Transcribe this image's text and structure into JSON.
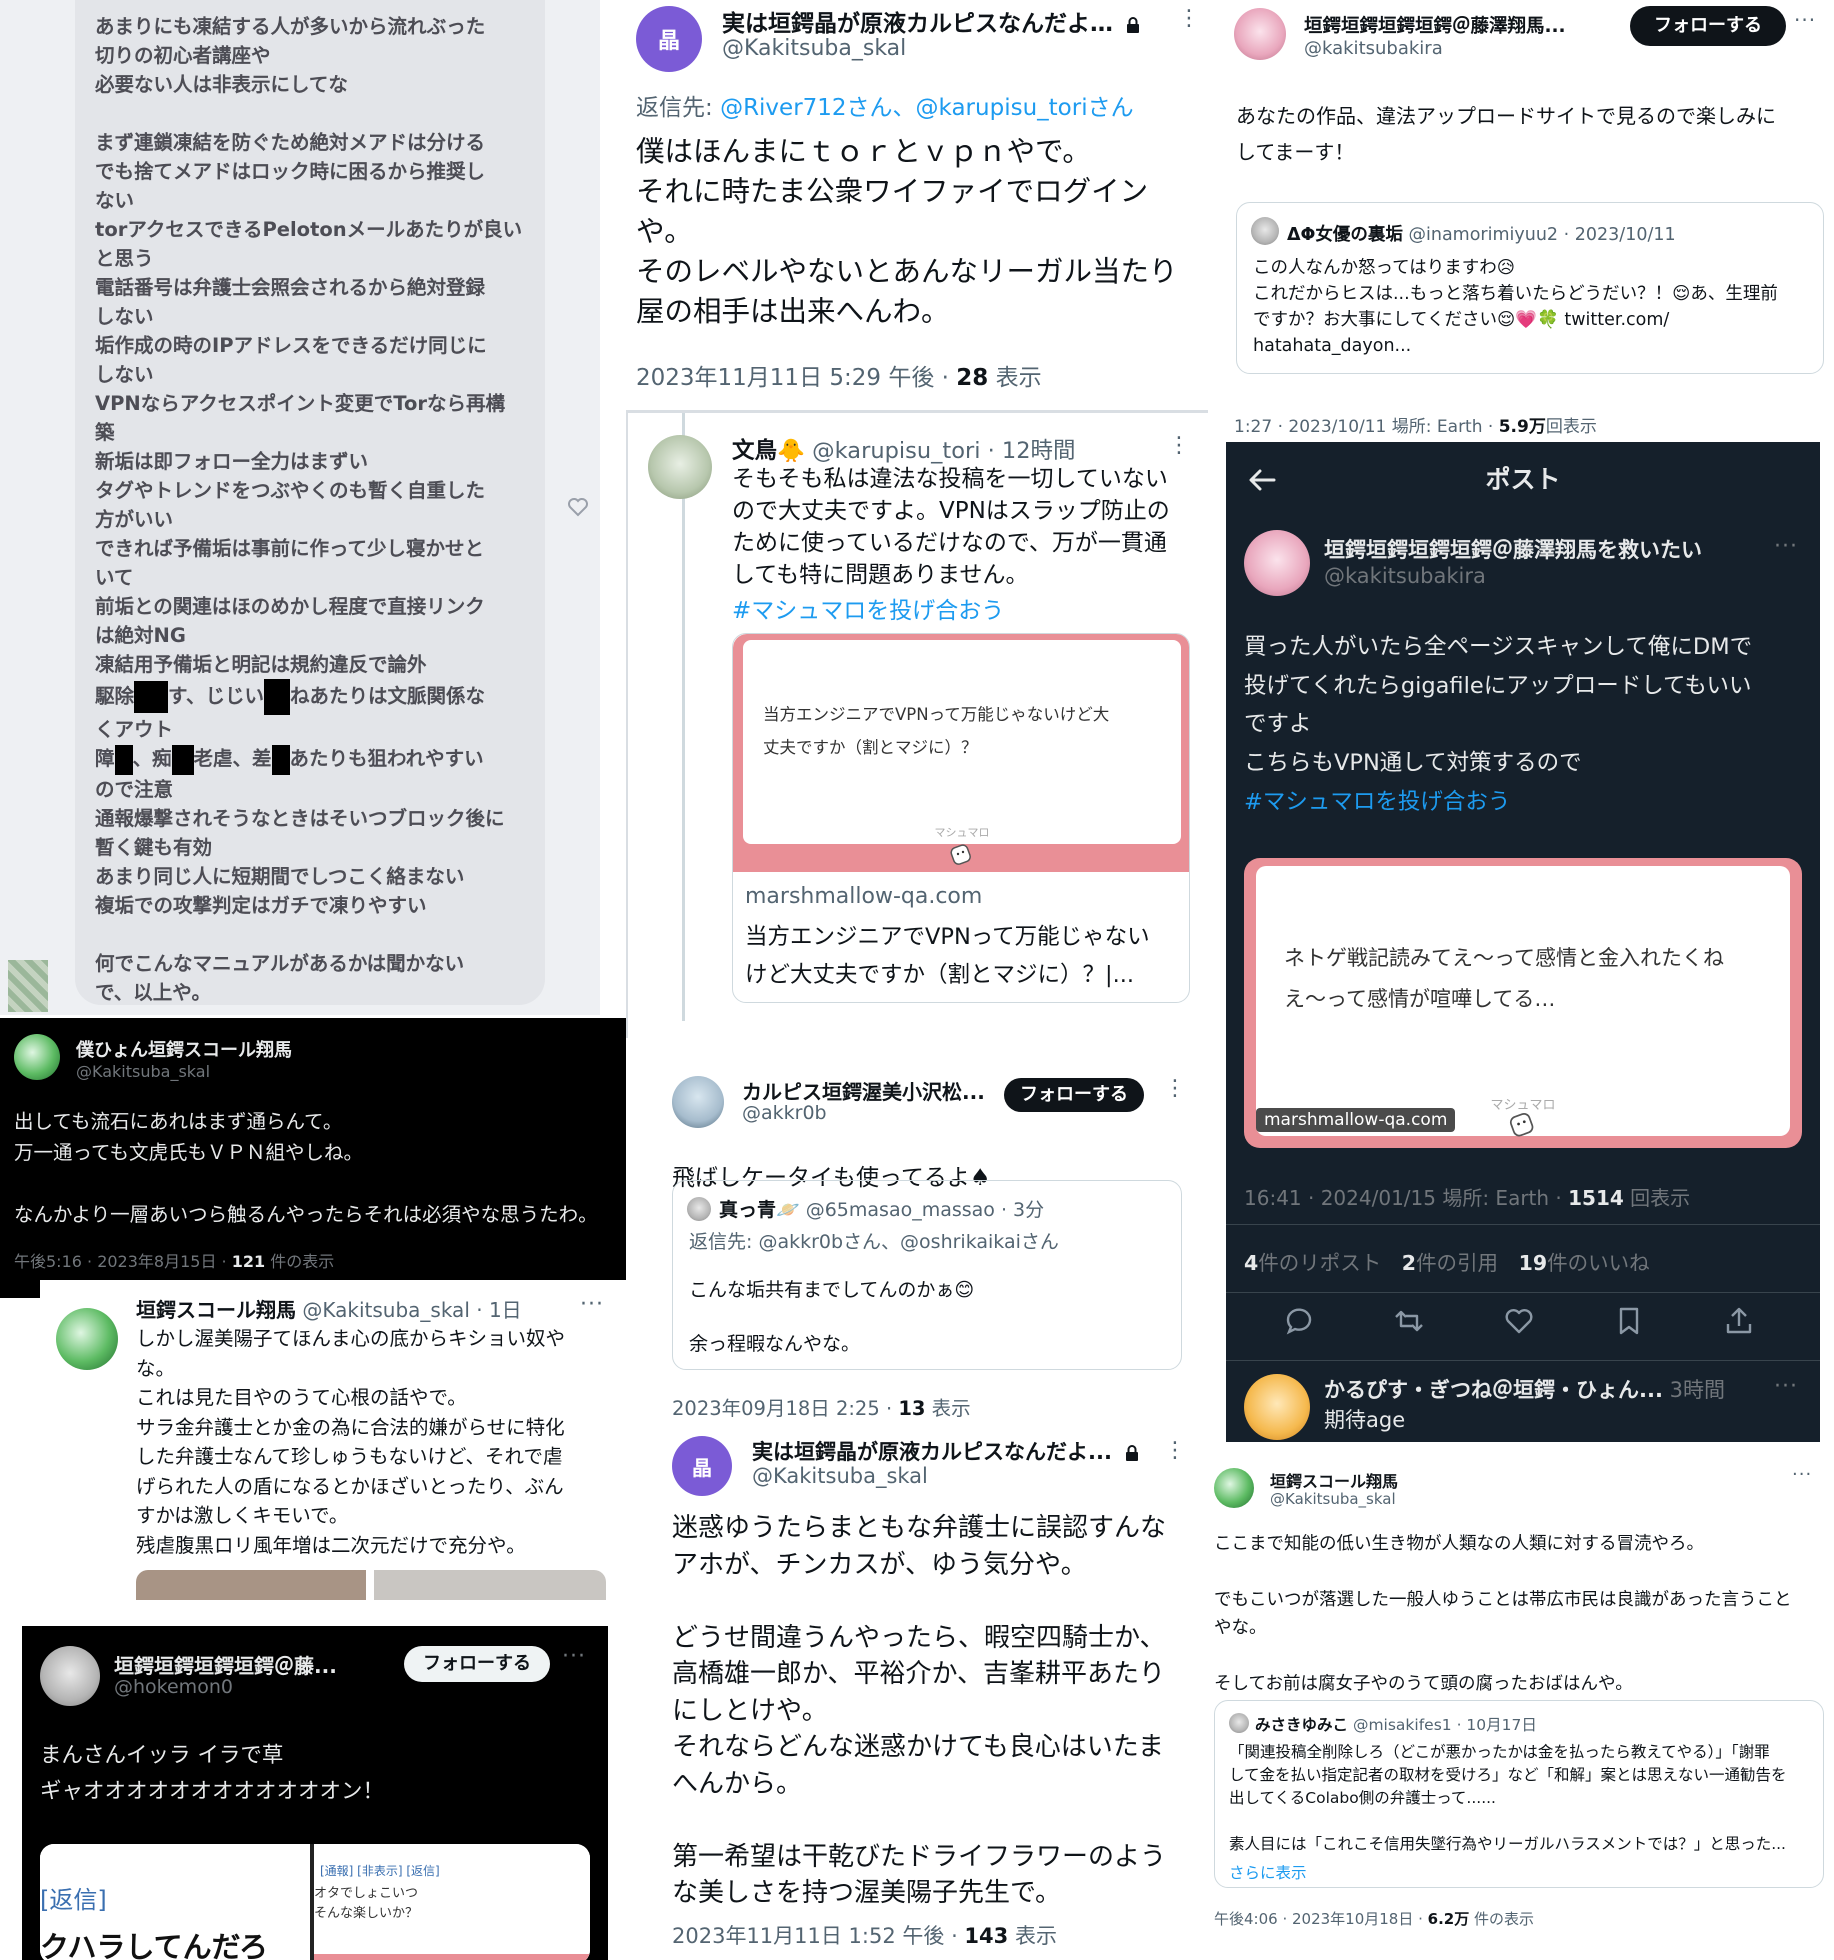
{
  "p1": {
    "lines": [
      "あまりにも凍結する人が多いから流れぶった",
      "切りの初心者講座や",
      "必要ない人は非表示にしてな",
      "",
      "まず連鎖凍結を防ぐため絶対メアドは分ける",
      "でも捨てメアドはロック時に困るから推奨し",
      "ない",
      "torアクセスできるPelotonメールあたりが良い",
      "と思う",
      "電話番号は弁護士会照会されるから絶対登録",
      "しない",
      "垢作成の時のIPアドレスをできるだけ同じに",
      "しない",
      "VPNならアクセスポイント変更でTorなら再構",
      "築",
      "新垢は即フォロー全力はまずい",
      "タグやトレンドをつぶやくのも暫く自重した",
      "方がいい",
      "できれば予備垢は事前に作って少し寝かせと",
      "いて",
      "前垢との関連はほのめかし程度で直接リンク",
      "は絶対NG",
      "凍結用予備垢と明記は規約違反で論外"
    ],
    "line_r1a": "駆除",
    "line_r1b": "す、じじい",
    "line_r1c": "ねあたりは文脈関係な",
    "line_r1d": "くアウト",
    "line_r2a": "障",
    "line_r2b": "、痴",
    "line_r2c": "老虐、差",
    "line_r2d": "あたりも狙われやすい",
    "lines_after": [
      "ので注意",
      "通報爆撃されそうなときはそいつブロック後に",
      "暫く鍵も有効",
      "あまり同じ人に短期間でしつこく絡まない",
      "複垢での攻撃判定はガチで凍りやすい",
      "",
      "何でこんなマニュアルがあるかは聞かない",
      "で、以上や。"
    ]
  },
  "p2": {
    "name": "実は垣鍔晶が原液カルピスなんだよ…",
    "handle": "@Kakitsuba_skal",
    "avatar_text": "晶",
    "reply_prefix": "返信先: ",
    "reply_to": "@River712さん、@karupisu_toriさん",
    "body": "僕はほんまにｔｏｒとｖｐｎやで。\nそれに時たま公衆ワイファイでログイン\nや。\nそのレベルやないとあんなリーガル当たり\n屋の相手は出来へんわ。",
    "time": "2023年11月11日 5:29 午後 · ",
    "views_count": "28",
    "views_label": " 表示"
  },
  "p3": {
    "name": "垣鍔垣鍔垣鍔垣鍔＠藤澤翔馬...",
    "handle": "@kakitsubakira",
    "follow": "フォローする",
    "body": "あなたの作品、違法アップロードサイトで見るので楽しみに\nしてまーす！",
    "q_name": "ΔΦ女優の裏垢",
    "q_handle": "@inamorimiyuu2 · 2023/10/11",
    "q_body": "この人なんか怒ってはりますわ😥\nこれだからヒスは...もっと落ち着いたらどうだい？！😌あ、生理前\nですか？お大事にしてください😌💗🍀 twitter.com/\nhatahata_dayon...",
    "meta_time": "1:27 · 2023/10/11 場所: Earth · ",
    "meta_views": "5.9万",
    "meta_label": "回表示"
  },
  "p4": {
    "name": "文鳥🐥",
    "handle": "@karupisu_tori · 12時間",
    "body": "そもそも私は違法な投稿を一切していない\nので大丈夫ですよ。VPNはスラップ防止の\nために使っているだけなので、万が一貫通\nしても特に問題ありません。",
    "hashtag": "#マシュマロを投げ合おう",
    "mm_question": "当方エンジニアでVPNって万能じゃないけど大\n丈夫ですか（割とマジに）？",
    "mm_label": "マシュマロ",
    "link_domain": "marshmallow-qa.com",
    "link_title": "当方エンジニアでVPNって万能じゃない\nけど大丈夫ですか（割とマジに）？|..."
  },
  "p5": {
    "header_title": "ポスト",
    "name": "垣鍔垣鍔垣鍔垣鍔＠藤澤翔馬を救いたい",
    "handle": "@kakitsubakira",
    "body": "買った人がいたら全ページスキャンして俺にDMで\n投げてくれたらgigafileにアップロードしてもいい\nですよ\nこちらもVPN通して対策するので",
    "hashtag": "#マシュマロを投げ合おう",
    "mm_question": "ネトゲ戦記読みてえ〜って感情と金入れたくね\nえ〜って感情が喧嘩してる…",
    "mm_label": "マシュマロ",
    "mm_domain": "marshmallow-qa.com",
    "meta": "16:41 · 2024/01/15 場所: Earth · ",
    "meta_views": "1514",
    "meta_label": " 回表示",
    "reposts_n": "4",
    "reposts_l": "件のリポスト",
    "quotes_n": "2",
    "quotes_l": "件の引用",
    "likes_n": "19",
    "likes_l": "件のいいね",
    "reply_name": "かるぴす・ぎつね＠垣鍔・ひょん...",
    "reply_time": "3時間",
    "reply_body": "期待age"
  },
  "p6": {
    "name": "僕ひょん垣鍔スコール翔馬",
    "handle": "@Kakitsuba_skal",
    "body": "出しても流石にあれはまず通らんて。\n万一通っても文虎氏もＶＰＮ組やしね。\n\nなんかより一層あいつら触るんやったらそれは必須やな思うたわ。",
    "time": "午後5:16 · 2023年8月15日 · ",
    "views": "121",
    "views_label": " 件の表示"
  },
  "p7": {
    "name": "垣鍔スコール翔馬",
    "handle": "@Kakitsuba_skal · 1日",
    "body": "しかし渥美陽子てほんま心の底からキショい奴や\nな。\nこれは見た目やのうて心根の話やで。\nサラ金弁護士とか金の為に合法的嫌がらせに特化\nした弁護士なんて珍しゅうもないけど、それで虐\nげられた人の盾になるとかほざいとったり、ぶん\nすかは激しくキモいで。\n残虐腹黒ロリ風年増は二次元だけで充分や。"
  },
  "p8": {
    "name": "カルピス垣鍔渥美小沢松...",
    "handle": "@akkr0b",
    "follow": "フォローする",
    "body": "飛ばしケータイも使ってるよ♠",
    "q_name": "真っ青🪐",
    "q_handle": "@65masao_massao · 3分",
    "q_reply": "返信先: @akkr0bさん、@oshrikaikaiさん",
    "q_body": "こんな垢共有までしてんのかぁ😊\n\n余っ程暇なんやな。",
    "time": "2023年09月18日 2:25 · ",
    "views": "13",
    "views_label": " 表示"
  },
  "p9": {
    "name": "実は垣鍔晶が原液カルピスなんだよ...",
    "handle": "@Kakitsuba_skal",
    "avatar_text": "晶",
    "body": "迷惑ゆうたらまともな弁護士に誤認すんな\nアホが、チンカスが、ゆう気分や。\n\nどうせ間違うんやったら、暇空四騎士か、\n高橋雄一郎か、平裕介か、吉峯耕平あたり\nにしとけや。\nそれならどんな迷惑かけても良心はいたま\nへんから。\n\n第一希望は干乾びたドライフラワーのよう\nな美しさを持つ渥美陽子先生で。",
    "time": "2023年11月11日 1:52 午後 · ",
    "views": "143",
    "views_label": " 表示"
  },
  "p10": {
    "name": "垣鍔スコール翔馬",
    "handle": "@Kakitsuba_skal",
    "body": "ここまで知能の低い生き物が人類なの人類に対する冒涜やろ。\n\nでもこいつが落選した一般人ゆうことは帯広市民は良識があった言うこと\nやな。\n\nそしてお前は腐女子やのうて頭の腐ったおばはんや。",
    "q_name": "みさきゆみこ",
    "q_handle": "@misakifes1 · 10月17日",
    "q_body": "「関連投稿全削除しろ（どこが悪かったかは金を払ったら教えてやる）」「謝罪\nして金を払い指定記者の取材を受けろ」など「和解」案とは思えない一通勧告を\n出してくるColabo側の弁護士って......\n\n素人目には「これこそ信用失墜行為やリーガルハラスメントでは？」と思った...",
    "q_more": "さらに表示",
    "time": "午後4:06 · 2023年10月18日 · ",
    "views": "6.2万",
    "views_label": " 件の表示"
  },
  "p11": {
    "name": "垣鍔垣鍔垣鍔垣鍔＠藤...",
    "handle": "@hokemon0",
    "follow": "フォローする",
    "body": "まんさんイッラ イラで草\nギャオオオオオオオオオオオオン！",
    "left_tag": "[返信]",
    "left_text": "クハラしてんだろ",
    "right_tags": "[通報] [非表示] [返信]",
    "right_text": "オタでしょこいつ\nそんな楽しいか？"
  }
}
